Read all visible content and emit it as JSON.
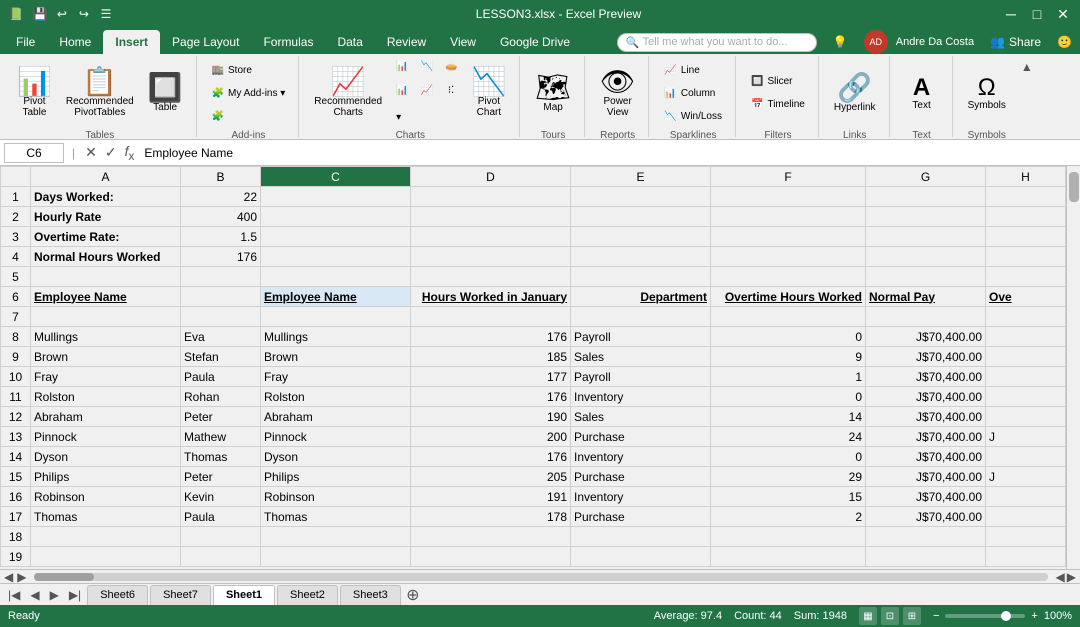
{
  "titleBar": {
    "title": "LESSON3.xlsx - Excel Preview",
    "icon": "📗",
    "windowControls": [
      "─",
      "□",
      "✕"
    ]
  },
  "ribbonTabs": {
    "tabs": [
      "File",
      "Home",
      "Insert",
      "Page Layout",
      "Formulas",
      "Data",
      "Review",
      "View",
      "Google Drive"
    ],
    "activeTab": "Insert"
  },
  "ribbonGroups": {
    "tables": {
      "label": "Tables",
      "buttons": [
        {
          "label": "PivotTable",
          "icon": "📊"
        },
        {
          "label": "Recommended PivotTables",
          "icon": "📋"
        },
        {
          "label": "Table",
          "icon": "🔲"
        }
      ]
    },
    "addins": {
      "label": "Add-ins",
      "buttons": [
        {
          "label": "Store",
          "icon": "🏬"
        },
        {
          "label": "My Add-ins",
          "icon": "🧩"
        }
      ]
    },
    "charts": {
      "label": "Charts",
      "buttons": [
        {
          "label": "Recommended Charts",
          "icon": "📈"
        },
        {
          "label": "Charts",
          "icon": "📊"
        },
        {
          "label": "PivotChart",
          "icon": "📉"
        }
      ]
    },
    "tours": {
      "label": "Tours",
      "buttons": [
        {
          "label": "Map",
          "icon": "🗺"
        }
      ]
    },
    "reports": {
      "label": "Reports",
      "buttons": [
        {
          "label": "Power View",
          "icon": "👁"
        }
      ]
    },
    "sparklines": {
      "label": "Sparklines",
      "items": [
        "Line",
        "Column",
        "Win/Loss"
      ]
    },
    "filters": {
      "label": "Filters",
      "items": [
        "Slicer",
        "Timeline"
      ]
    },
    "links": {
      "label": "Links",
      "buttons": [
        {
          "label": "Hyperlink",
          "icon": "🔗"
        }
      ]
    },
    "text_group": {
      "label": "Text",
      "buttons": [
        {
          "label": "Text",
          "icon": "A"
        }
      ]
    },
    "symbols_group": {
      "label": "Symbols",
      "buttons": [
        {
          "label": "Symbols",
          "icon": "Ω"
        }
      ]
    }
  },
  "searchBox": {
    "placeholder": "Tell me what you want to do..."
  },
  "userArea": {
    "name": "Andre Da Costa",
    "shareLabel": "Share"
  },
  "formulaBar": {
    "cellRef": "C6",
    "formula": "Employee Name"
  },
  "columns": {
    "headers": [
      "",
      "A",
      "B",
      "C",
      "D",
      "E",
      "F",
      "G",
      "H"
    ]
  },
  "spreadsheet": {
    "rows": [
      {
        "num": 1,
        "cells": [
          {
            "col": "A",
            "val": "Days Worked:",
            "bold": true
          },
          {
            "col": "B",
            "val": "22",
            "right": true
          },
          {
            "col": "C",
            "val": ""
          },
          {
            "col": "D",
            "val": ""
          },
          {
            "col": "E",
            "val": ""
          },
          {
            "col": "F",
            "val": ""
          },
          {
            "col": "G",
            "val": ""
          },
          {
            "col": "H",
            "val": ""
          }
        ]
      },
      {
        "num": 2,
        "cells": [
          {
            "col": "A",
            "val": "Hourly Rate",
            "bold": true
          },
          {
            "col": "B",
            "val": "400",
            "right": true
          },
          {
            "col": "C",
            "val": ""
          },
          {
            "col": "D",
            "val": ""
          },
          {
            "col": "E",
            "val": ""
          },
          {
            "col": "F",
            "val": ""
          },
          {
            "col": "G",
            "val": ""
          },
          {
            "col": "H",
            "val": ""
          }
        ]
      },
      {
        "num": 3,
        "cells": [
          {
            "col": "A",
            "val": "Overtime Rate:",
            "bold": true
          },
          {
            "col": "B",
            "val": "1.5",
            "right": true
          },
          {
            "col": "C",
            "val": ""
          },
          {
            "col": "D",
            "val": ""
          },
          {
            "col": "E",
            "val": ""
          },
          {
            "col": "F",
            "val": ""
          },
          {
            "col": "G",
            "val": ""
          },
          {
            "col": "H",
            "val": ""
          }
        ]
      },
      {
        "num": 4,
        "cells": [
          {
            "col": "A",
            "val": "Normal Hours Worked",
            "bold": true
          },
          {
            "col": "B",
            "val": "176",
            "right": true
          },
          {
            "col": "C",
            "val": ""
          },
          {
            "col": "D",
            "val": ""
          },
          {
            "col": "E",
            "val": ""
          },
          {
            "col": "F",
            "val": ""
          },
          {
            "col": "G",
            "val": ""
          },
          {
            "col": "H",
            "val": ""
          }
        ]
      },
      {
        "num": 5,
        "cells": [
          {
            "col": "A",
            "val": ""
          },
          {
            "col": "B",
            "val": ""
          },
          {
            "col": "C",
            "val": ""
          },
          {
            "col": "D",
            "val": ""
          },
          {
            "col": "E",
            "val": ""
          },
          {
            "col": "F",
            "val": ""
          },
          {
            "col": "G",
            "val": ""
          },
          {
            "col": "H",
            "val": ""
          }
        ]
      },
      {
        "num": 6,
        "cells": [
          {
            "col": "A",
            "val": "Employee Name",
            "bold": true,
            "underline": true
          },
          {
            "col": "B",
            "val": ""
          },
          {
            "col": "C",
            "val": "Employee Name",
            "bold": true,
            "underline": true,
            "selected": true
          },
          {
            "col": "D",
            "val": "Hours Worked in January",
            "bold": true,
            "underline": true,
            "right": true
          },
          {
            "col": "E",
            "val": "Department",
            "bold": true,
            "underline": true,
            "right": true
          },
          {
            "col": "F",
            "val": "Overtime Hours Worked",
            "bold": true,
            "underline": true,
            "right": true
          },
          {
            "col": "G",
            "val": "Normal Pay",
            "bold": true,
            "underline": true
          },
          {
            "col": "H",
            "val": "Ove",
            "bold": true,
            "underline": true
          }
        ]
      },
      {
        "num": 7,
        "cells": [
          {
            "col": "A",
            "val": ""
          },
          {
            "col": "B",
            "val": ""
          },
          {
            "col": "C",
            "val": ""
          },
          {
            "col": "D",
            "val": ""
          },
          {
            "col": "E",
            "val": ""
          },
          {
            "col": "F",
            "val": ""
          },
          {
            "col": "G",
            "val": ""
          },
          {
            "col": "H",
            "val": ""
          }
        ]
      },
      {
        "num": 8,
        "cells": [
          {
            "col": "A",
            "val": "Mullings"
          },
          {
            "col": "B",
            "val": "Eva"
          },
          {
            "col": "C",
            "val": "Mullings"
          },
          {
            "col": "D",
            "val": "176",
            "right": true
          },
          {
            "col": "E",
            "val": "Payroll"
          },
          {
            "col": "F",
            "val": "0",
            "right": true
          },
          {
            "col": "G",
            "val": "J$70,400.00",
            "right": true
          },
          {
            "col": "H",
            "val": ""
          }
        ]
      },
      {
        "num": 9,
        "cells": [
          {
            "col": "A",
            "val": "Brown"
          },
          {
            "col": "B",
            "val": "Stefan"
          },
          {
            "col": "C",
            "val": "Brown"
          },
          {
            "col": "D",
            "val": "185",
            "right": true
          },
          {
            "col": "E",
            "val": "Sales"
          },
          {
            "col": "F",
            "val": "9",
            "right": true
          },
          {
            "col": "G",
            "val": "J$70,400.00",
            "right": true
          },
          {
            "col": "H",
            "val": ""
          }
        ]
      },
      {
        "num": 10,
        "cells": [
          {
            "col": "A",
            "val": "Fray"
          },
          {
            "col": "B",
            "val": "Paula"
          },
          {
            "col": "C",
            "val": "Fray"
          },
          {
            "col": "D",
            "val": "177",
            "right": true
          },
          {
            "col": "E",
            "val": "Payroll"
          },
          {
            "col": "F",
            "val": "1",
            "right": true
          },
          {
            "col": "G",
            "val": "J$70,400.00",
            "right": true
          },
          {
            "col": "H",
            "val": ""
          }
        ]
      },
      {
        "num": 11,
        "cells": [
          {
            "col": "A",
            "val": "Rolston"
          },
          {
            "col": "B",
            "val": "Rohan"
          },
          {
            "col": "C",
            "val": "Rolston"
          },
          {
            "col": "D",
            "val": "176",
            "right": true
          },
          {
            "col": "E",
            "val": "Inventory"
          },
          {
            "col": "F",
            "val": "0",
            "right": true
          },
          {
            "col": "G",
            "val": "J$70,400.00",
            "right": true
          },
          {
            "col": "H",
            "val": ""
          }
        ]
      },
      {
        "num": 12,
        "cells": [
          {
            "col": "A",
            "val": "Abraham"
          },
          {
            "col": "B",
            "val": "Peter"
          },
          {
            "col": "C",
            "val": "Abraham"
          },
          {
            "col": "D",
            "val": "190",
            "right": true
          },
          {
            "col": "E",
            "val": "Sales"
          },
          {
            "col": "F",
            "val": "14",
            "right": true
          },
          {
            "col": "G",
            "val": "J$70,400.00",
            "right": true
          },
          {
            "col": "H",
            "val": ""
          }
        ]
      },
      {
        "num": 13,
        "cells": [
          {
            "col": "A",
            "val": "Pinnock"
          },
          {
            "col": "B",
            "val": "Mathew"
          },
          {
            "col": "C",
            "val": "Pinnock"
          },
          {
            "col": "D",
            "val": "200",
            "right": true
          },
          {
            "col": "E",
            "val": "Purchase"
          },
          {
            "col": "F",
            "val": "24",
            "right": true
          },
          {
            "col": "G",
            "val": "J$70,400.00",
            "right": true
          },
          {
            "col": "H",
            "val": "J"
          }
        ]
      },
      {
        "num": 14,
        "cells": [
          {
            "col": "A",
            "val": "Dyson"
          },
          {
            "col": "B",
            "val": "Thomas"
          },
          {
            "col": "C",
            "val": "Dyson"
          },
          {
            "col": "D",
            "val": "176",
            "right": true
          },
          {
            "col": "E",
            "val": "Inventory"
          },
          {
            "col": "F",
            "val": "0",
            "right": true
          },
          {
            "col": "G",
            "val": "J$70,400.00",
            "right": true
          },
          {
            "col": "H",
            "val": ""
          }
        ]
      },
      {
        "num": 15,
        "cells": [
          {
            "col": "A",
            "val": "Philips"
          },
          {
            "col": "B",
            "val": "Peter"
          },
          {
            "col": "C",
            "val": "Philips"
          },
          {
            "col": "D",
            "val": "205",
            "right": true
          },
          {
            "col": "E",
            "val": "Purchase"
          },
          {
            "col": "F",
            "val": "29",
            "right": true
          },
          {
            "col": "G",
            "val": "J$70,400.00",
            "right": true
          },
          {
            "col": "H",
            "val": "J"
          }
        ]
      },
      {
        "num": 16,
        "cells": [
          {
            "col": "A",
            "val": "Robinson"
          },
          {
            "col": "B",
            "val": "Kevin"
          },
          {
            "col": "C",
            "val": "Robinson"
          },
          {
            "col": "D",
            "val": "191",
            "right": true
          },
          {
            "col": "E",
            "val": "Inventory"
          },
          {
            "col": "F",
            "val": "15",
            "right": true
          },
          {
            "col": "G",
            "val": "J$70,400.00",
            "right": true
          },
          {
            "col": "H",
            "val": ""
          }
        ]
      },
      {
        "num": 17,
        "cells": [
          {
            "col": "A",
            "val": "Thomas"
          },
          {
            "col": "B",
            "val": "Paula"
          },
          {
            "col": "C",
            "val": "Thomas"
          },
          {
            "col": "D",
            "val": "178",
            "right": true
          },
          {
            "col": "E",
            "val": "Purchase"
          },
          {
            "col": "F",
            "val": "2",
            "right": true
          },
          {
            "col": "G",
            "val": "J$70,400.00",
            "right": true
          },
          {
            "col": "H",
            "val": ""
          }
        ]
      },
      {
        "num": 18,
        "cells": [
          {
            "col": "A",
            "val": ""
          },
          {
            "col": "B",
            "val": ""
          },
          {
            "col": "C",
            "val": ""
          },
          {
            "col": "D",
            "val": ""
          },
          {
            "col": "E",
            "val": ""
          },
          {
            "col": "F",
            "val": ""
          },
          {
            "col": "G",
            "val": ""
          },
          {
            "col": "H",
            "val": ""
          }
        ]
      },
      {
        "num": 19,
        "cells": [
          {
            "col": "A",
            "val": ""
          },
          {
            "col": "B",
            "val": ""
          },
          {
            "col": "C",
            "val": ""
          },
          {
            "col": "D",
            "val": ""
          },
          {
            "col": "E",
            "val": ""
          },
          {
            "col": "F",
            "val": ""
          },
          {
            "col": "G",
            "val": ""
          },
          {
            "col": "H",
            "val": ""
          }
        ]
      }
    ]
  },
  "sheetTabs": {
    "tabs": [
      "Sheet6",
      "Sheet7",
      "Sheet1",
      "Sheet2",
      "Sheet3"
    ],
    "activeTab": "Sheet1"
  },
  "statusBar": {
    "status": "Ready",
    "average": "Average: 97.4",
    "count": "Count: 44",
    "sum": "Sum: 1948",
    "zoom": "100%"
  }
}
